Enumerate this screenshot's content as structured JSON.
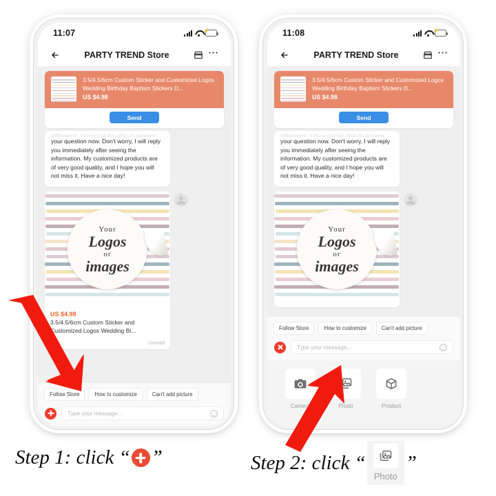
{
  "phones": [
    {
      "id": "left",
      "status": {
        "time": "11:07",
        "signal_icon": "signal-bars-icon",
        "wifi_icon": "wifi-icon",
        "battery_icon": "battery-charging-icon"
      },
      "header": {
        "back_icon": "back-arrow-icon",
        "title": "PARTY TREND Store",
        "store_icon": "storefront-icon",
        "more_icon": "more-options-icon"
      },
      "promo": {
        "title": "3.5/4.5/6cm Custom Sticker and Customized Logos Wedding Birthday Baptism Stickers D...",
        "price": "US $4.98",
        "send_label": "Send",
        "thumb_icon": "product-thumbnail"
      },
      "bubble": {
        "clipped_line": "difference, I may not be able to answer",
        "text": "your question now. Don't worry, I will reply you immediately after seeing the information. My customized products are of very good quality, and I hope you will not miss it. Have a nice day!"
      },
      "image_card": {
        "sticker": {
          "line1": "Your",
          "line2": "Logos",
          "line3": "or",
          "line4": "images"
        },
        "price": "US $4.98",
        "description": "3.5/4.5/6cm Custom Sticker and Customized Logos Wedding Bi...",
        "status": "Unread",
        "avatar_icon": "user-avatar-icon"
      },
      "quick_replies": [
        "Follow Store",
        "How to customize",
        "Can't add picture"
      ],
      "composer": {
        "action_icon": "plus-icon",
        "placeholder": "Type your message...",
        "emoji_icon": "smiley-icon"
      },
      "attachment_panel": null
    },
    {
      "id": "right",
      "status": {
        "time": "11:08",
        "signal_icon": "signal-bars-icon",
        "wifi_icon": "wifi-icon",
        "battery_icon": "battery-charging-icon"
      },
      "header": {
        "back_icon": "back-arrow-icon",
        "title": "PARTY TREND Store",
        "store_icon": "storefront-icon",
        "more_icon": "more-options-icon"
      },
      "promo": {
        "title": "3.5/4.5/6cm Custom Sticker and Customized Logos Wedding Birthday Baptism Stickers D...",
        "price": "US $4.98",
        "send_label": "Send",
        "thumb_icon": "product-thumbnail"
      },
      "bubble": {
        "clipped_line": "difference, I may not be able to answer",
        "text": "your question now. Don't worry, I will reply you immediately after seeing the information. My customized products are of very good quality, and I hope you will not miss it. Have a nice day!"
      },
      "image_card": {
        "sticker": {
          "line1": "Your",
          "line2": "Logos",
          "line3": "or",
          "line4": "images"
        },
        "price": "",
        "description": "",
        "status": "",
        "avatar_icon": "user-avatar-icon"
      },
      "quick_replies": [
        "Follow Store",
        "How to customize",
        "Can't add picture"
      ],
      "composer": {
        "action_icon": "close-icon",
        "placeholder": "Type your message...",
        "emoji_icon": "smiley-icon"
      },
      "attachment_panel": {
        "items": [
          {
            "label": "Camera",
            "icon": "camera-icon"
          },
          {
            "label": "Photo",
            "icon": "photo-gallery-icon"
          },
          {
            "label": "Product",
            "icon": "product-box-icon"
          }
        ]
      }
    }
  ],
  "annotations": {
    "arrow_color": "#f01b0e",
    "arrow_1": "down-right-arrow-to-plus-button",
    "arrow_2": "up-right-arrow-to-photo-button"
  },
  "captions": {
    "step1": {
      "prefix": "Step 1: click “",
      "icon": "plus-icon",
      "suffix": "”"
    },
    "step2": {
      "prefix": "Step 2: click “",
      "icon": "photo-gallery-icon",
      "icon_label": "Photo",
      "suffix": "”"
    }
  },
  "colors": {
    "promo_banner": "#e8886a",
    "send_button": "#3a8ee6",
    "price_orange": "#e8662b",
    "action_red": "#ef3b2d",
    "arrow_red": "#f01b0e",
    "caption_plus": "#ea4a33"
  },
  "sticker_stripes": [
    "#d9c4cc",
    "#8fa7b4",
    "#f2dfa6",
    "#e8c3cb",
    "#b9a0a8",
    "#cfe0e4",
    "#f3e2c0",
    "#e3bfc6"
  ]
}
